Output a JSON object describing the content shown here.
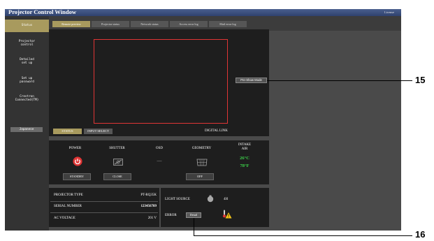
{
  "window": {
    "title": "Projector Control Window",
    "license_label": "License"
  },
  "sidebar": {
    "items": [
      {
        "label": "Status"
      },
      {
        "label": "Projector\ncontrol"
      },
      {
        "label": "Detailed\nset up"
      },
      {
        "label": "Set up\npassword"
      },
      {
        "label": "Crestron\nConnected(TM)"
      }
    ],
    "language": "Japanese"
  },
  "tabs": [
    "Remote preview",
    "Projector status",
    "Network status",
    "Access error log",
    "Mail error log"
  ],
  "preview": {
    "preshow_button": "Pre-Show Mode",
    "subtabs": [
      "STATUS",
      "INPUT SELECT"
    ],
    "input_label": "DIGITAL LINK"
  },
  "status": {
    "power": {
      "label": "POWER",
      "state": "STANDBY"
    },
    "shutter": {
      "label": "SHUTTER",
      "state": "CLOSE"
    },
    "osd": {
      "label": "OSD",
      "value": "—"
    },
    "geometry": {
      "label": "GEOMETRY",
      "state": "OFF"
    },
    "intake_air": {
      "label_line1": "INTAKE",
      "label_line2": "AIR",
      "celsius": "26°C",
      "fahrenheit": "78°F"
    }
  },
  "info": {
    "projector_type": {
      "label": "PROJECTOR TYPE",
      "value": "PT-RQ35K"
    },
    "serial_number": {
      "label": "SERIAL NUMBER",
      "value": "123456789"
    },
    "ac_voltage": {
      "label": "AC VOLTAGE",
      "value": "201 V"
    }
  },
  "light": {
    "label": "LIGHT SOURCE",
    "value": "4H"
  },
  "error": {
    "label": "ERROR",
    "detail_button": "Detail"
  },
  "callouts": {
    "pre_show": "15",
    "detail": "16"
  },
  "colors": {
    "accent": "#a89a5e",
    "temp": "#3cd54a",
    "frame": "#e03535",
    "power_icon": "#e03535"
  }
}
